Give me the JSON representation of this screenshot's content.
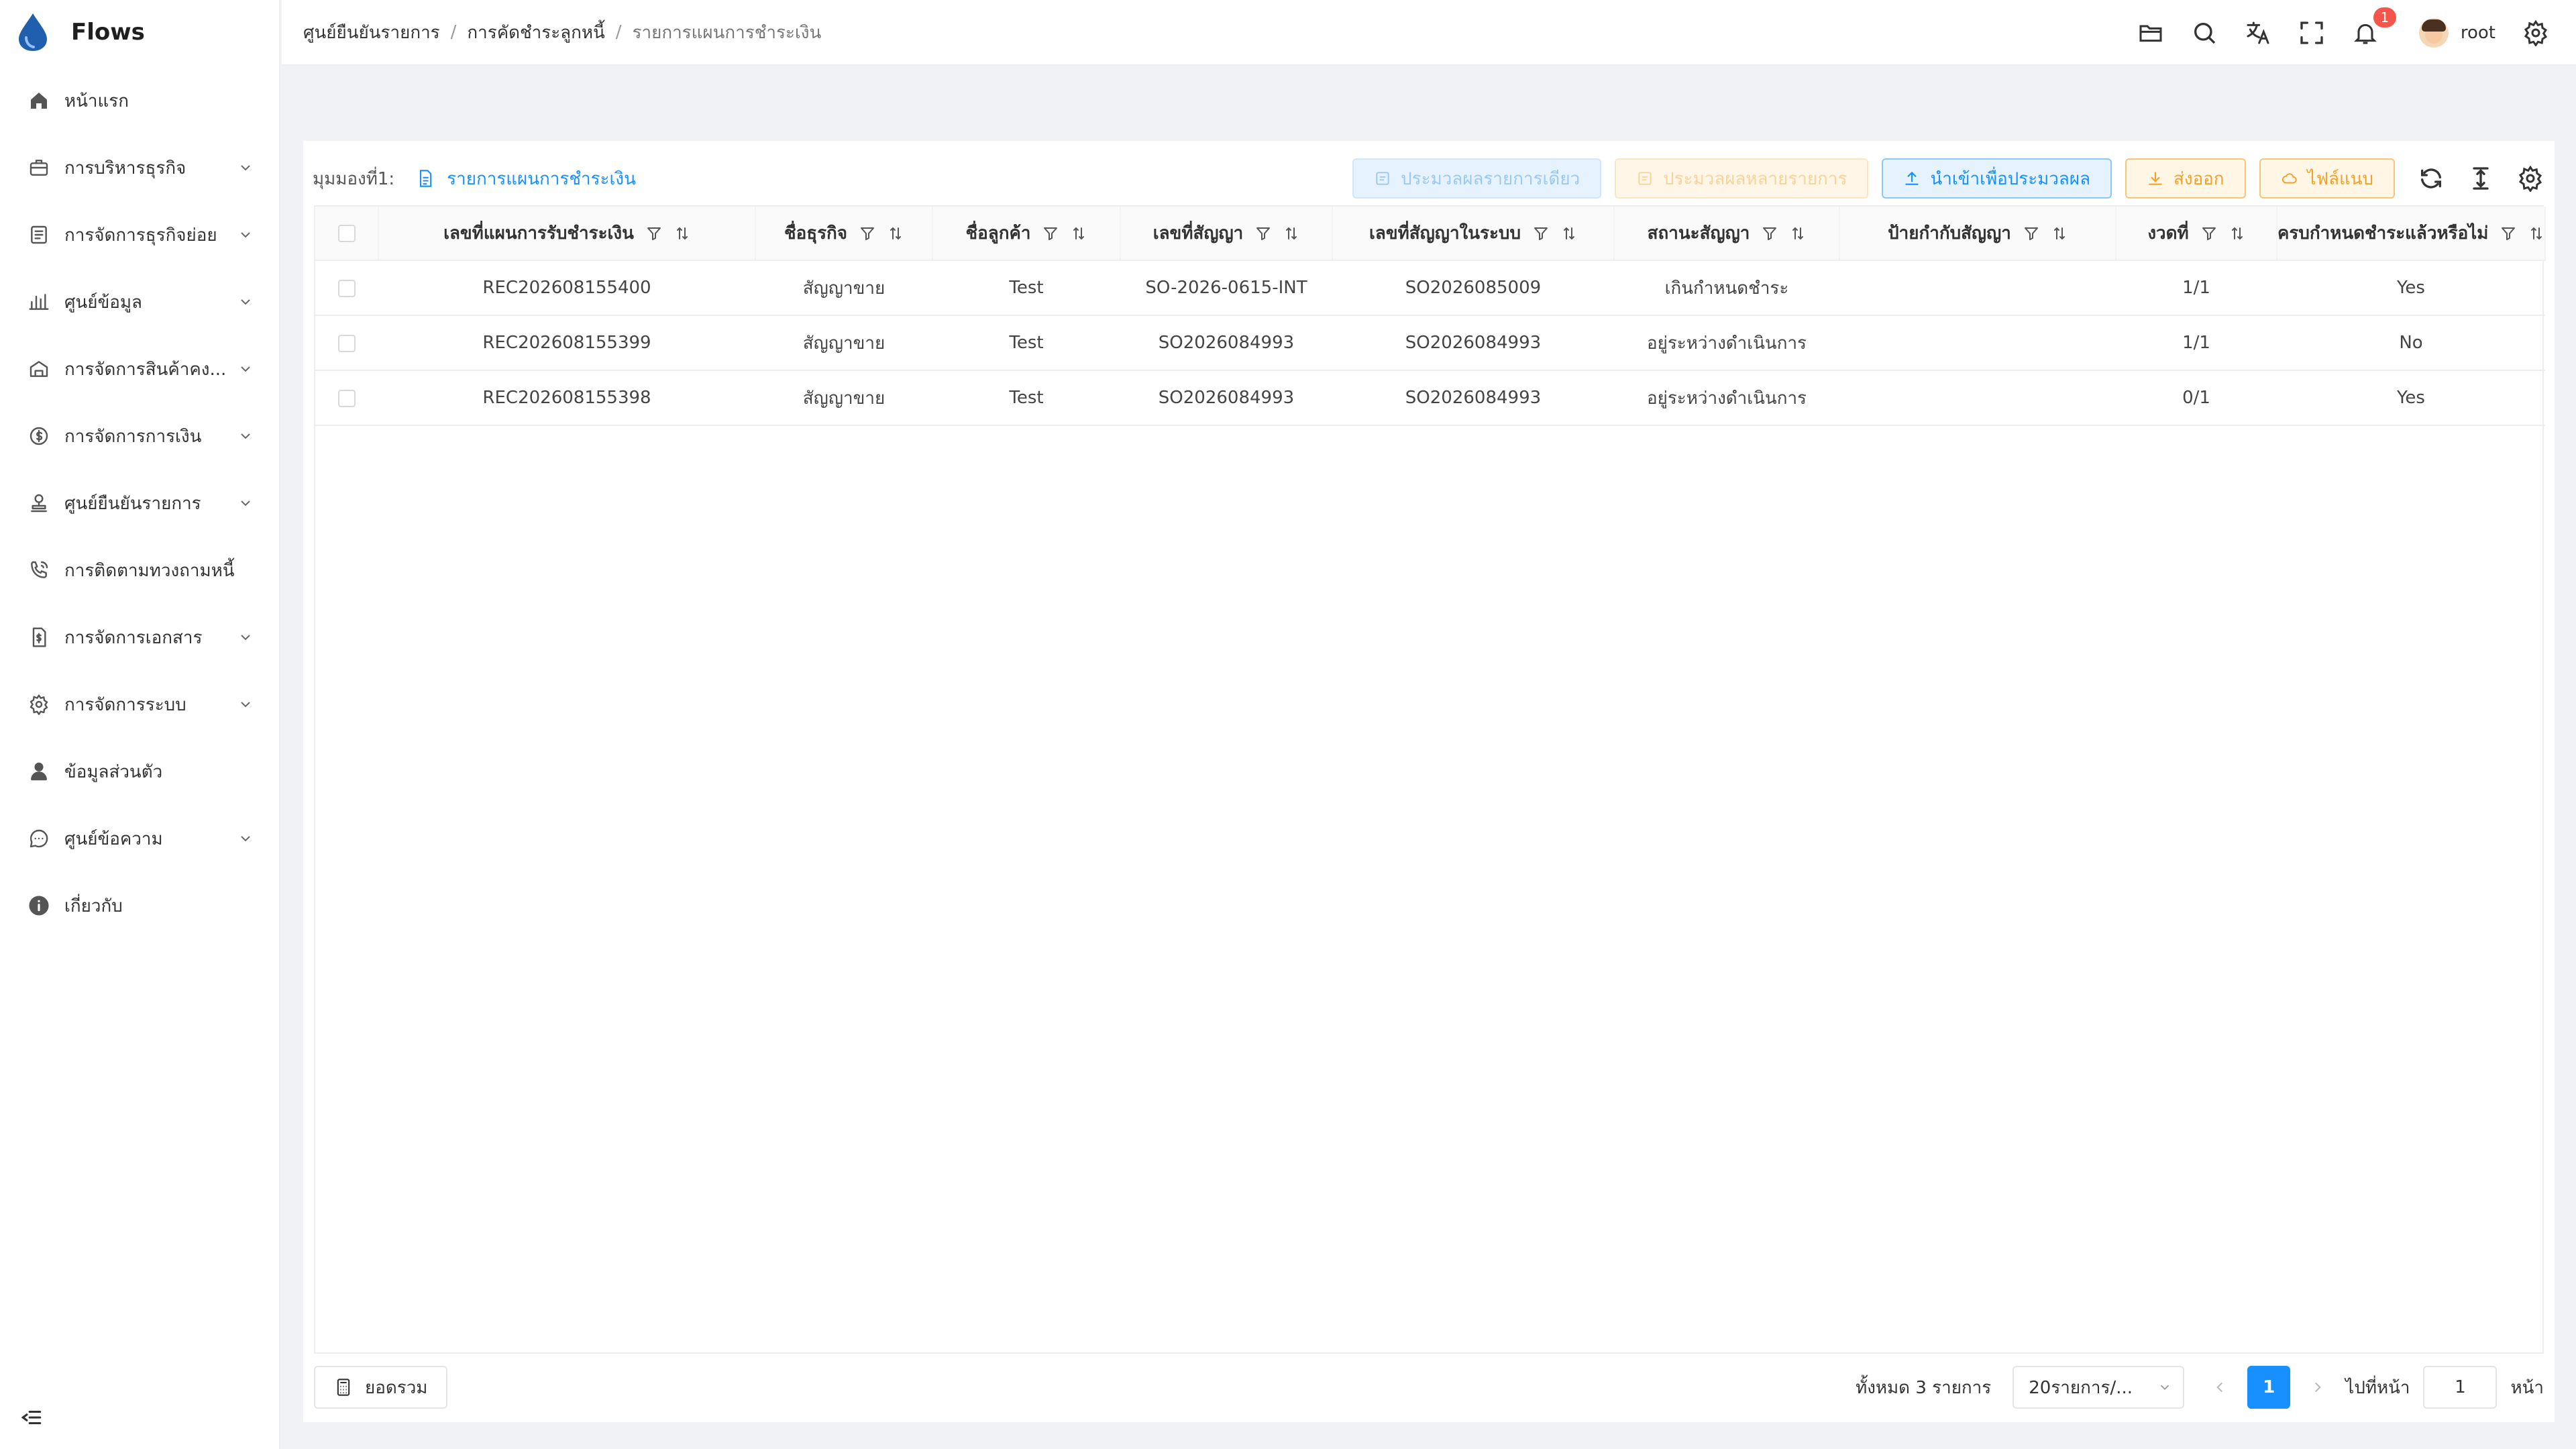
{
  "app": {
    "name": "Flows"
  },
  "sidebar": {
    "items": [
      {
        "label": "หน้าแรก",
        "icon": "home-icon",
        "expandable": false
      },
      {
        "label": "การบริหารธุรกิจ",
        "icon": "briefcase-icon",
        "expandable": true
      },
      {
        "label": "การจัดการธุรกิจย่อย",
        "icon": "document-list-icon",
        "expandable": true
      },
      {
        "label": "ศูนย์ข้อมูล",
        "icon": "bar-chart-icon",
        "expandable": true
      },
      {
        "label": "การจัดการสินค้าคง...",
        "icon": "warehouse-icon",
        "expandable": true
      },
      {
        "label": "การจัดการการเงิน",
        "icon": "dollar-circle-icon",
        "expandable": true
      },
      {
        "label": "ศูนย์ยืนยันรายการ",
        "icon": "stamp-icon",
        "expandable": true
      },
      {
        "label": "การติดตามทวงถามหนี้",
        "icon": "phone-call-icon",
        "expandable": false
      },
      {
        "label": "การจัดการเอกสาร",
        "icon": "file-dollar-icon",
        "expandable": true
      },
      {
        "label": "การจัดการระบบ",
        "icon": "gear-icon",
        "expandable": true
      },
      {
        "label": "ข้อมูลส่วนตัว",
        "icon": "user-icon",
        "expandable": false
      },
      {
        "label": "ศูนย์ข้อความ",
        "icon": "message-icon",
        "expandable": true
      },
      {
        "label": "เกี่ยวกับ",
        "icon": "info-icon",
        "expandable": false
      }
    ]
  },
  "breadcrumb": [
    "ศูนย์ยืนยันรายการ",
    "การคัดชำระลูกหนี้",
    "รายการแผนการชำระเงิน"
  ],
  "header": {
    "notification_count": "1",
    "username": "root"
  },
  "toolbar": {
    "view_label": "มุมมองที่1:",
    "view_name": "รายการแผนการชำระเงิน",
    "buttons": {
      "process_single": "ประมวลผลรายการเดียว",
      "process_multiple": "ประมวลผลหลายรายการ",
      "import_process": "นำเข้าเพื่อประมวลผล",
      "export": "ส่งออก",
      "attachment": "ไฟล์แนบ"
    }
  },
  "table": {
    "columns": [
      "เลขที่แผนการรับชำระเงิน",
      "ชื่อธุรกิจ",
      "ชื่อลูกค้า",
      "เลขที่สัญญา",
      "เลขที่สัญญาในระบบ",
      "สถานะสัญญา",
      "ป้ายกำกับสัญญา",
      "งวดที่",
      "ครบกำหนดชำระแล้วหรือไม่"
    ],
    "rows": [
      [
        "REC202608155400",
        "สัญญาขาย",
        "Test",
        "SO-2026-0615-INT",
        "SO2026085009",
        "เกินกำหนดชำระ",
        "",
        "1/1",
        "Yes"
      ],
      [
        "REC202608155399",
        "สัญญาขาย",
        "Test",
        "SO2026084993",
        "SO2026084993",
        "อยู่ระหว่างดำเนินการ",
        "",
        "1/1",
        "No"
      ],
      [
        "REC202608155398",
        "สัญญาขาย",
        "Test",
        "SO2026084993",
        "SO2026084993",
        "อยู่ระหว่างดำเนินการ",
        "",
        "0/1",
        "Yes"
      ]
    ]
  },
  "footer": {
    "summary_label": "ยอดรวม",
    "total_text": "ทั้งหมด 3 รายการ",
    "page_size": "20รายการ/...",
    "current_page": "1",
    "goto_label": "ไปที่หน้า",
    "goto_value": "1",
    "page_unit": "หน้า"
  }
}
